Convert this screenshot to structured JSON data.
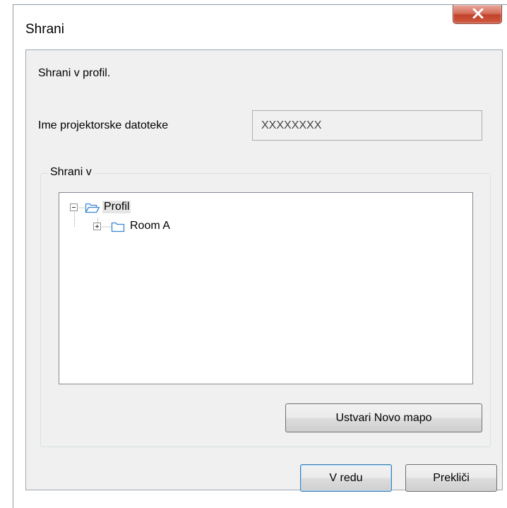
{
  "window": {
    "title": "Shrani"
  },
  "content": {
    "instruction": "Shrani v profil.",
    "file_name_label": "Ime projektorske datoteke",
    "file_name_value": "XXXXXXXX"
  },
  "save_in": {
    "group_label": "Shrani v",
    "tree": {
      "root_label": "Profil",
      "child_label": "Room A"
    },
    "new_folder_button": "Ustvari Novo mapo"
  },
  "footer": {
    "ok_button": "V redu",
    "cancel_button": "Prekliči"
  },
  "icons": {
    "close": "close-icon",
    "collapse": "minus-box-icon",
    "expand": "plus-box-icon",
    "open_folder": "folder-open-icon",
    "folder": "folder-icon"
  },
  "colors": {
    "close_button": "#c2432b",
    "folder_outline": "#3b86d4",
    "default_button_border": "#3c7fb1"
  }
}
